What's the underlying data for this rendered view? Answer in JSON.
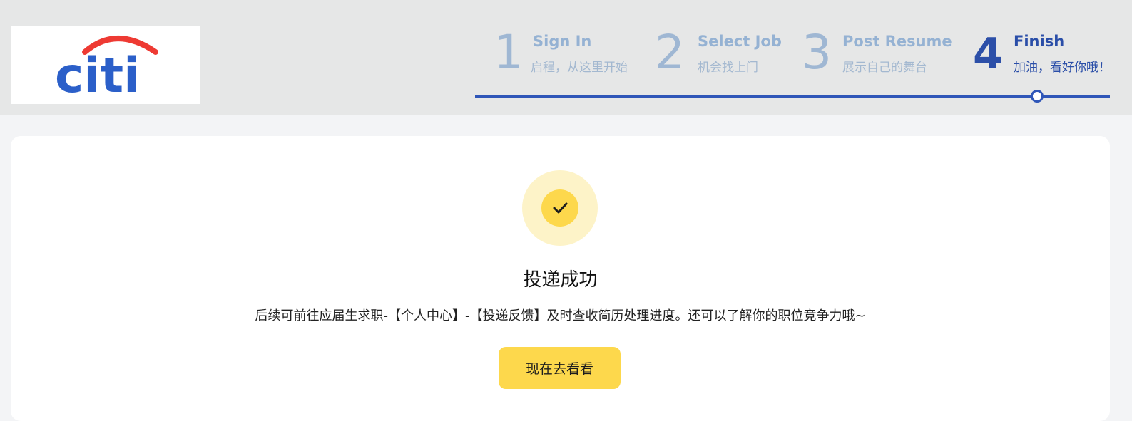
{
  "brand": {
    "logo_text": "citi",
    "logo_color": "#2b5fc9",
    "arc_color": "#ee3a33"
  },
  "steps": [
    {
      "number": "1",
      "title": "Sign In",
      "subtitle": "启程，从这里开始",
      "state": "done"
    },
    {
      "number": "2",
      "title": "Select Job",
      "subtitle": "机会找上门",
      "state": "done"
    },
    {
      "number": "3",
      "title": "Post Resume",
      "subtitle": "展示自己的舞台",
      "state": "done"
    },
    {
      "number": "4",
      "title": "Finish",
      "subtitle": "加油，看好你哦！",
      "state": "active"
    }
  ],
  "progress": {
    "current_step": 4,
    "total_steps": 4,
    "accent_color": "#2f56b8"
  },
  "result": {
    "icon": "check-icon",
    "title": "投递成功",
    "description": "后续可前往应届生求职-【个人中心】-【投递反馈】及时查收简历处理进度。还可以了解你的职位竞争力哦~",
    "button_label": "现在去看看",
    "button_color": "#fdd84c"
  }
}
